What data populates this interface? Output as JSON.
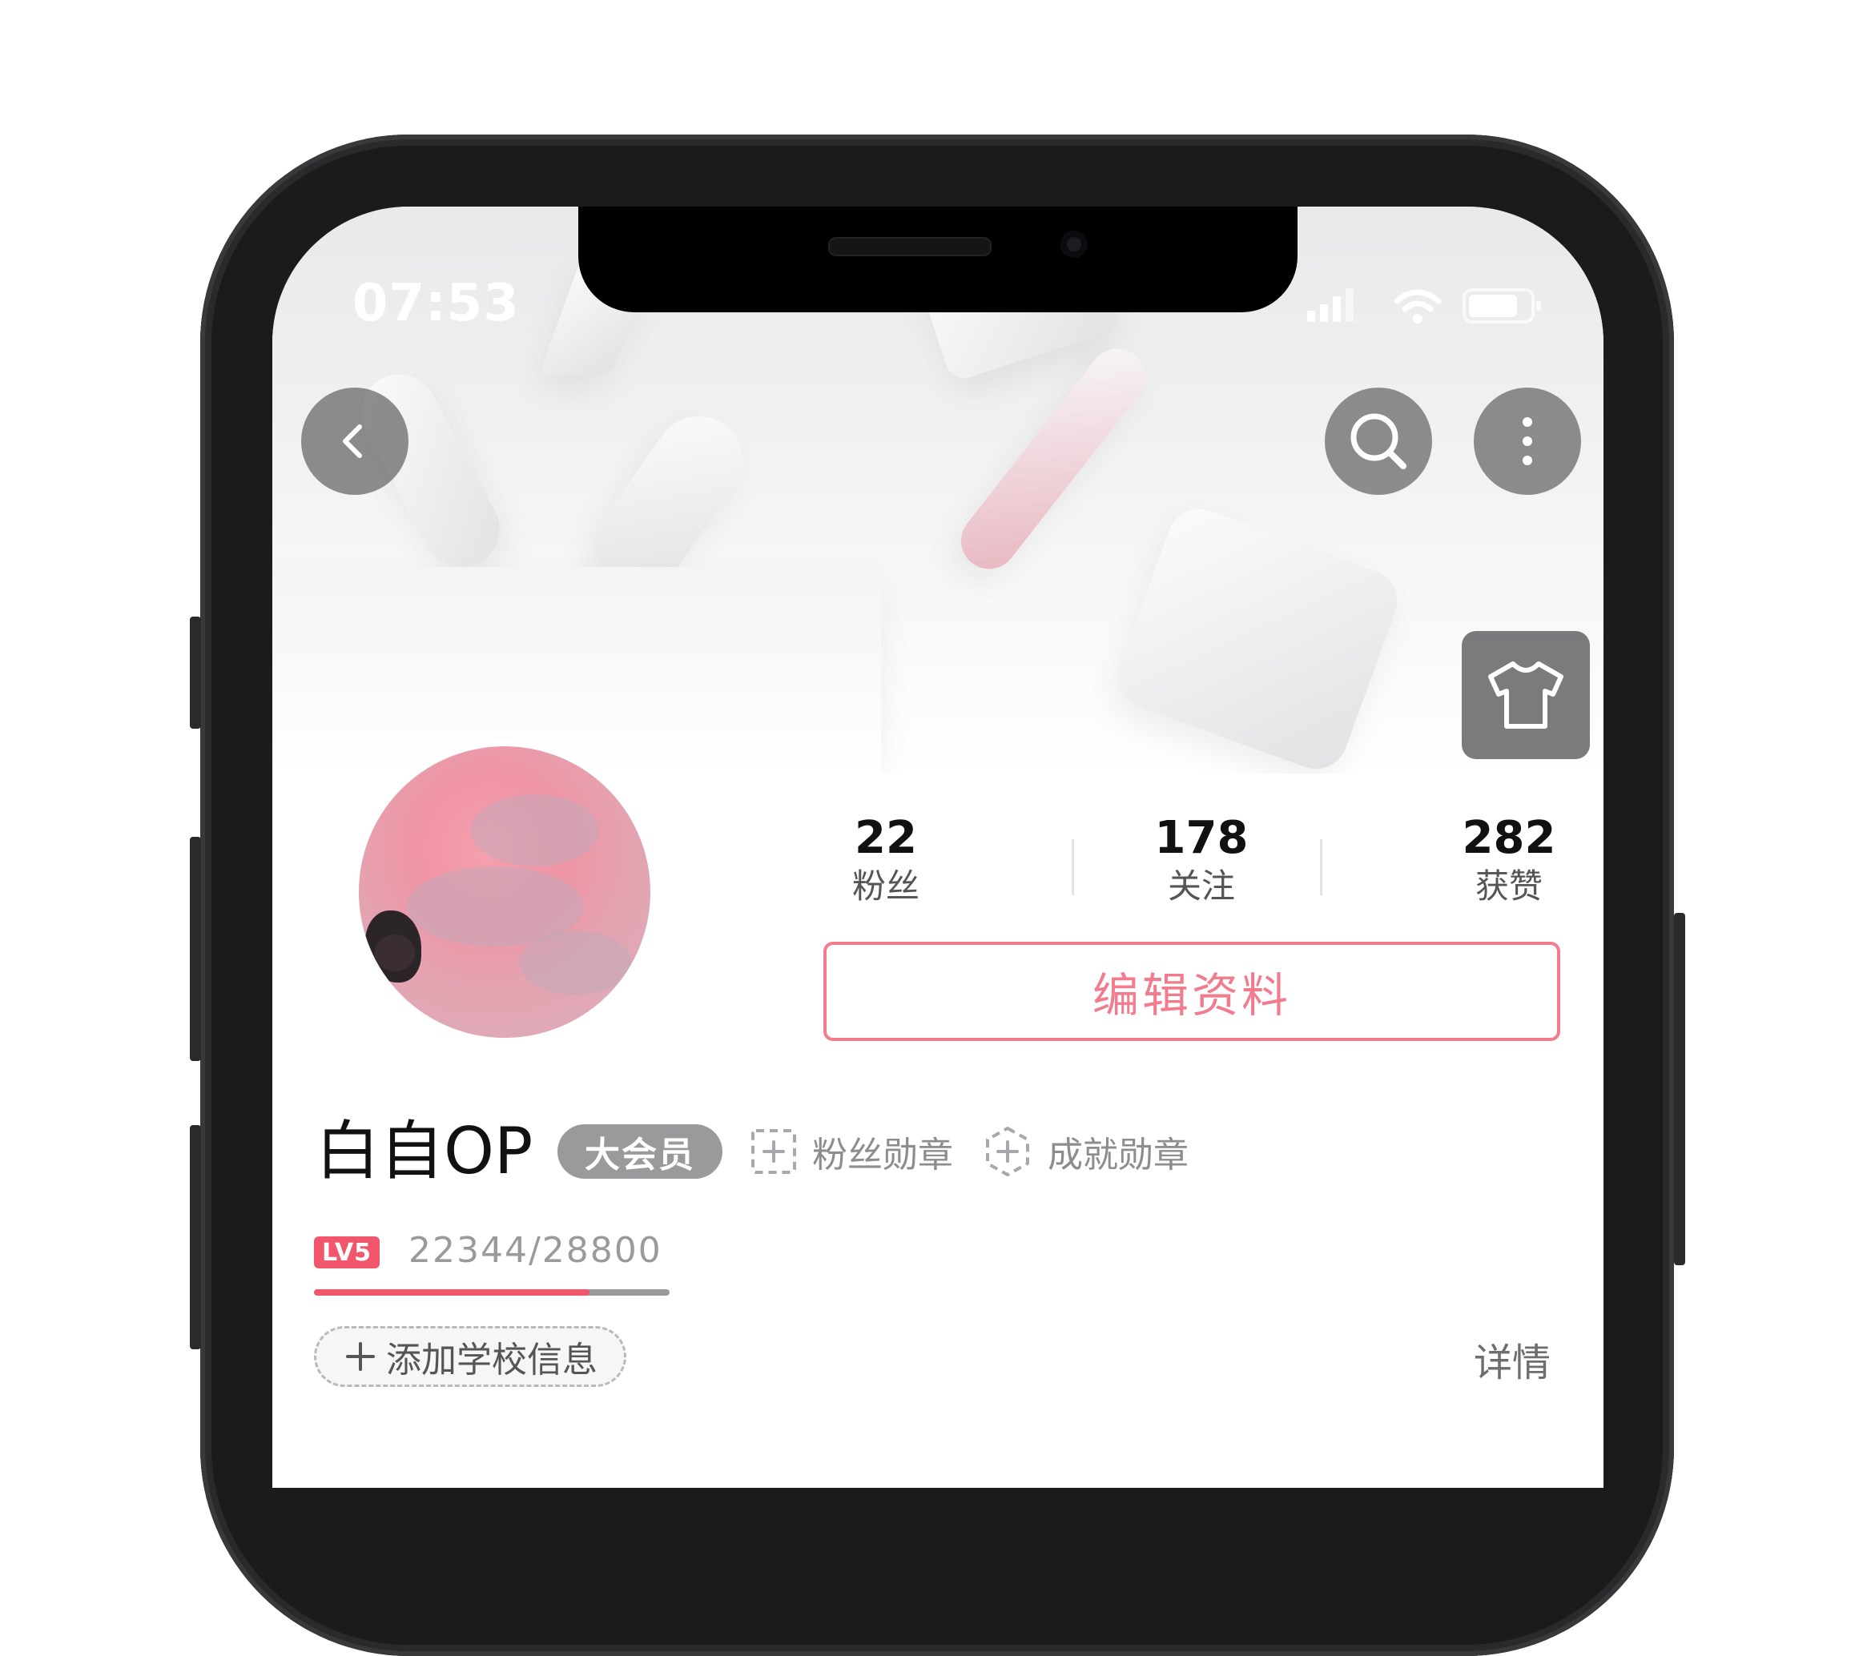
{
  "status_bar": {
    "time": "07:53"
  },
  "header": {
    "back_icon": "chevron-left-icon",
    "search_icon": "search-icon",
    "more_icon": "more-vertical-icon",
    "skin_icon": "tshirt-icon"
  },
  "stats": [
    {
      "value": "22",
      "label": "粉丝"
    },
    {
      "value": "178",
      "label": "关注"
    },
    {
      "value": "282",
      "label": "获赞"
    }
  ],
  "profile": {
    "edit_label": "编辑资料",
    "username": "白自OP",
    "vip_label": "大会员",
    "fan_medal_label": "粉丝勋章",
    "achievement_label": "成就勋章",
    "level_badge": "LV5",
    "exp_text": "22344/28800",
    "exp_current": 22344,
    "exp_max": 28800,
    "school_label": "添加学校信息",
    "school_icon": "plus-icon",
    "detail_label": "详情"
  },
  "colors": {
    "accent": "#f27c8d",
    "level_red": "#f2566c",
    "badge_gray": "#9a9a9d"
  }
}
